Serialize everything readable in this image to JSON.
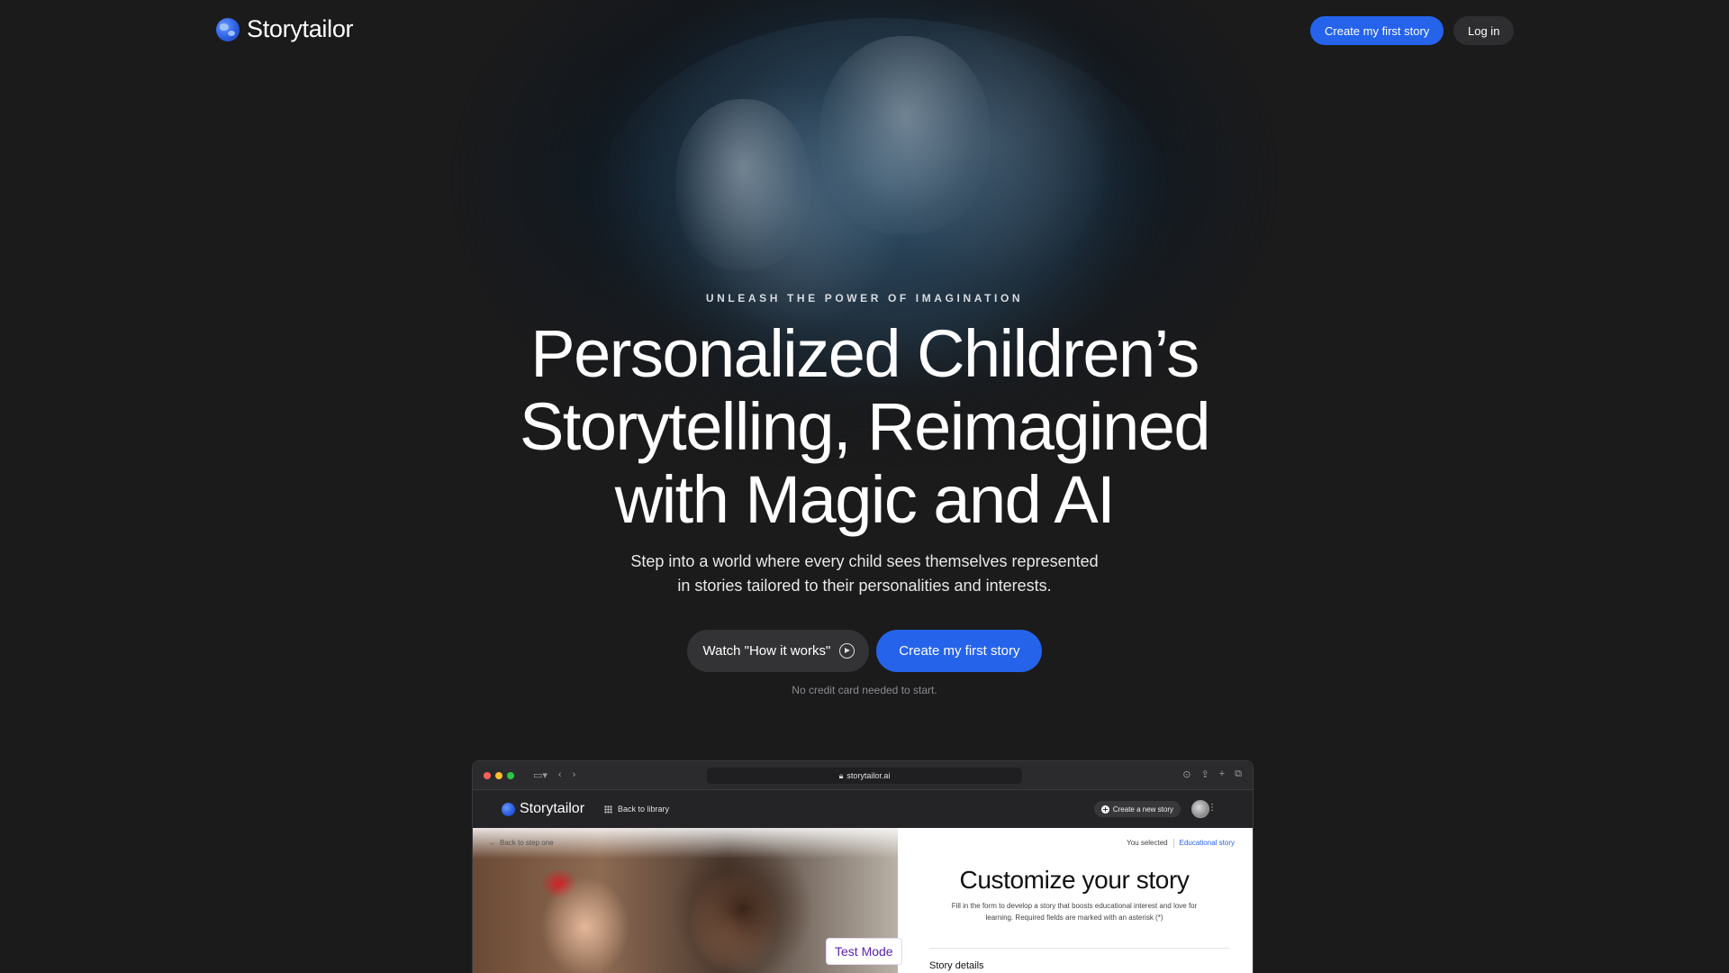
{
  "nav": {
    "logo_text": "Storytailor",
    "create_label": "Create my first story",
    "login_label": "Log in"
  },
  "hero": {
    "eyebrow": "UNLEASH THE POWER OF IMAGINATION",
    "headline_lines": [
      "Personalized Children’s",
      "Storytelling, Reimagined",
      "with Magic and AI"
    ],
    "subtext_lines": [
      "Step into a world where every child sees themselves represented",
      "in stories tailored to their personalities and interests."
    ],
    "watch_label": "Watch \"How it works\"",
    "create_label": "Create my first story",
    "no_cc": "No credit card needed to start."
  },
  "mockup": {
    "url": "storytailor.ai",
    "logo_text": "Storytailor",
    "back_to_library": "Back to library",
    "create_new_story": "Create a new story",
    "back_to_step": "Back to step one",
    "you_selected": "You selected",
    "selected_value": "Educational story",
    "title": "Customize your story",
    "description": "Fill in the form to develop a story that boosts educational interest and love for learning. Required fields are marked with an asterisk (*)",
    "section_label": "Story details",
    "badge": "Test Mode"
  },
  "icons": [
    "globe-logo-icon",
    "play-circle-icon",
    "lock-icon",
    "reload-icon",
    "grid-icon",
    "plus-icon",
    "arrow-left-icon"
  ],
  "colors": {
    "accent": "#2563eb",
    "background": "#1b1b1c",
    "test_mode": "#5b21b6"
  }
}
